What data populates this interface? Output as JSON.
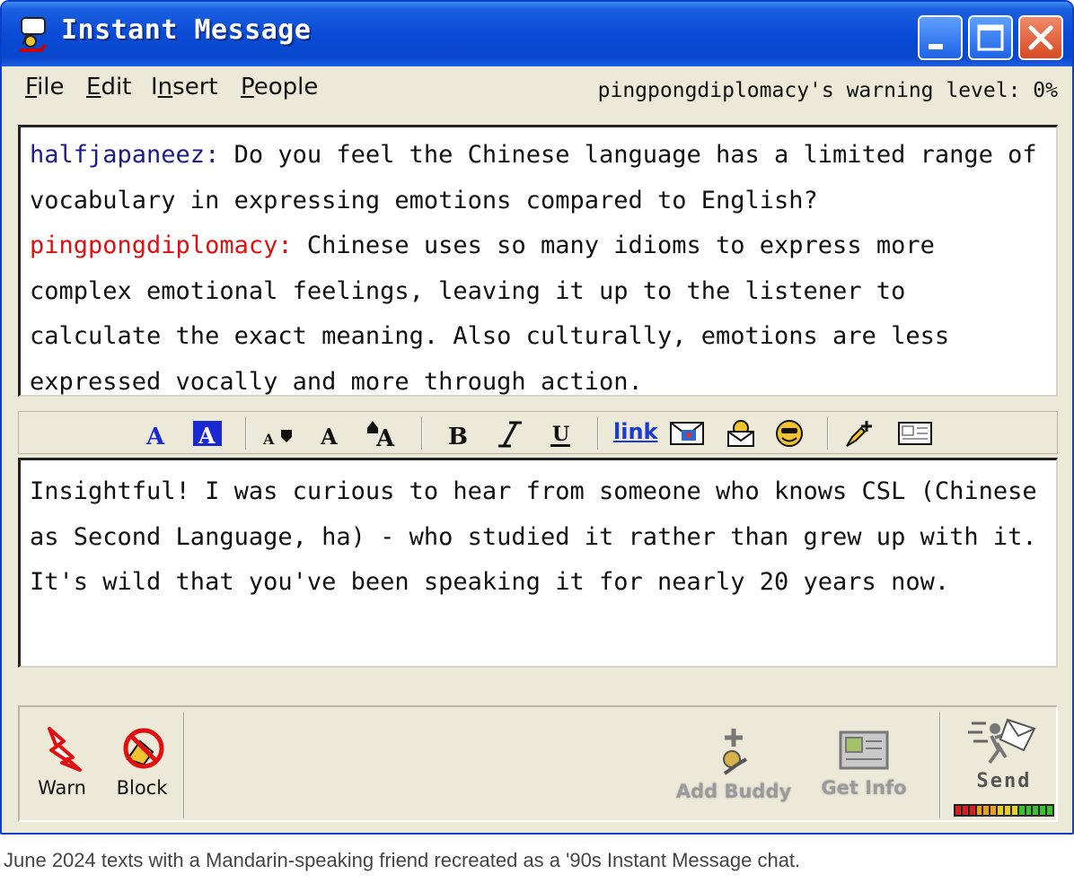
{
  "window": {
    "title": "Instant Message"
  },
  "menu": {
    "items": [
      {
        "label": "File",
        "accel": "F",
        "rest": "ile"
      },
      {
        "label": "Edit",
        "accel": "E",
        "rest": "dit"
      },
      {
        "label": "Insert",
        "pre": "I",
        "accel": "n",
        "rest": "sert"
      },
      {
        "label": "People",
        "accel": "P",
        "rest": "eople"
      }
    ],
    "warning_text": "pingpongdiplomacy's warning level: 0%"
  },
  "chat": {
    "messages": [
      {
        "sender": "halfjapaneez:",
        "text": " Do you feel the Chinese language has a limited range of vocabulary in expressing emotions compared to English?"
      },
      {
        "sender": "pingpongdiplomacy:",
        "text": " Chinese uses so many idioms to express more complex emotional feelings, leaving it up to the listener to calculate the exact meaning. Also culturally, emotions are less expressed vocally and more through action."
      }
    ]
  },
  "compose": {
    "value": "Insightful! I was curious to hear from someone who knows CSL (Chinese as Second Language, ha) - who studied it rather than grew up with it. It's wild that you've been speaking it for nearly 20 years now."
  },
  "toolbar": {
    "link_label": "link",
    "icons": [
      "text-color-icon",
      "background-color-icon",
      "decrease-font-icon",
      "normal-font-icon",
      "increase-font-icon",
      "bold-icon",
      "italic-icon",
      "underline-icon",
      "insert-image-icon",
      "send-email-icon",
      "smiley-icon",
      "add-link-icon",
      "insert-card-icon"
    ]
  },
  "actions": {
    "warn": "Warn",
    "block": "Block",
    "add_buddy": "Add Buddy",
    "get_info": "Get Info",
    "send": "Send"
  },
  "caption": "June 2024 texts with a Mandarin-speaking friend recreated as a '90s Instant Message chat.",
  "colors": {
    "titlebar": "#0a4bd6",
    "sender_self": "#1b1b8a",
    "sender_other": "#e01010",
    "window_bg": "#ece9d8"
  }
}
